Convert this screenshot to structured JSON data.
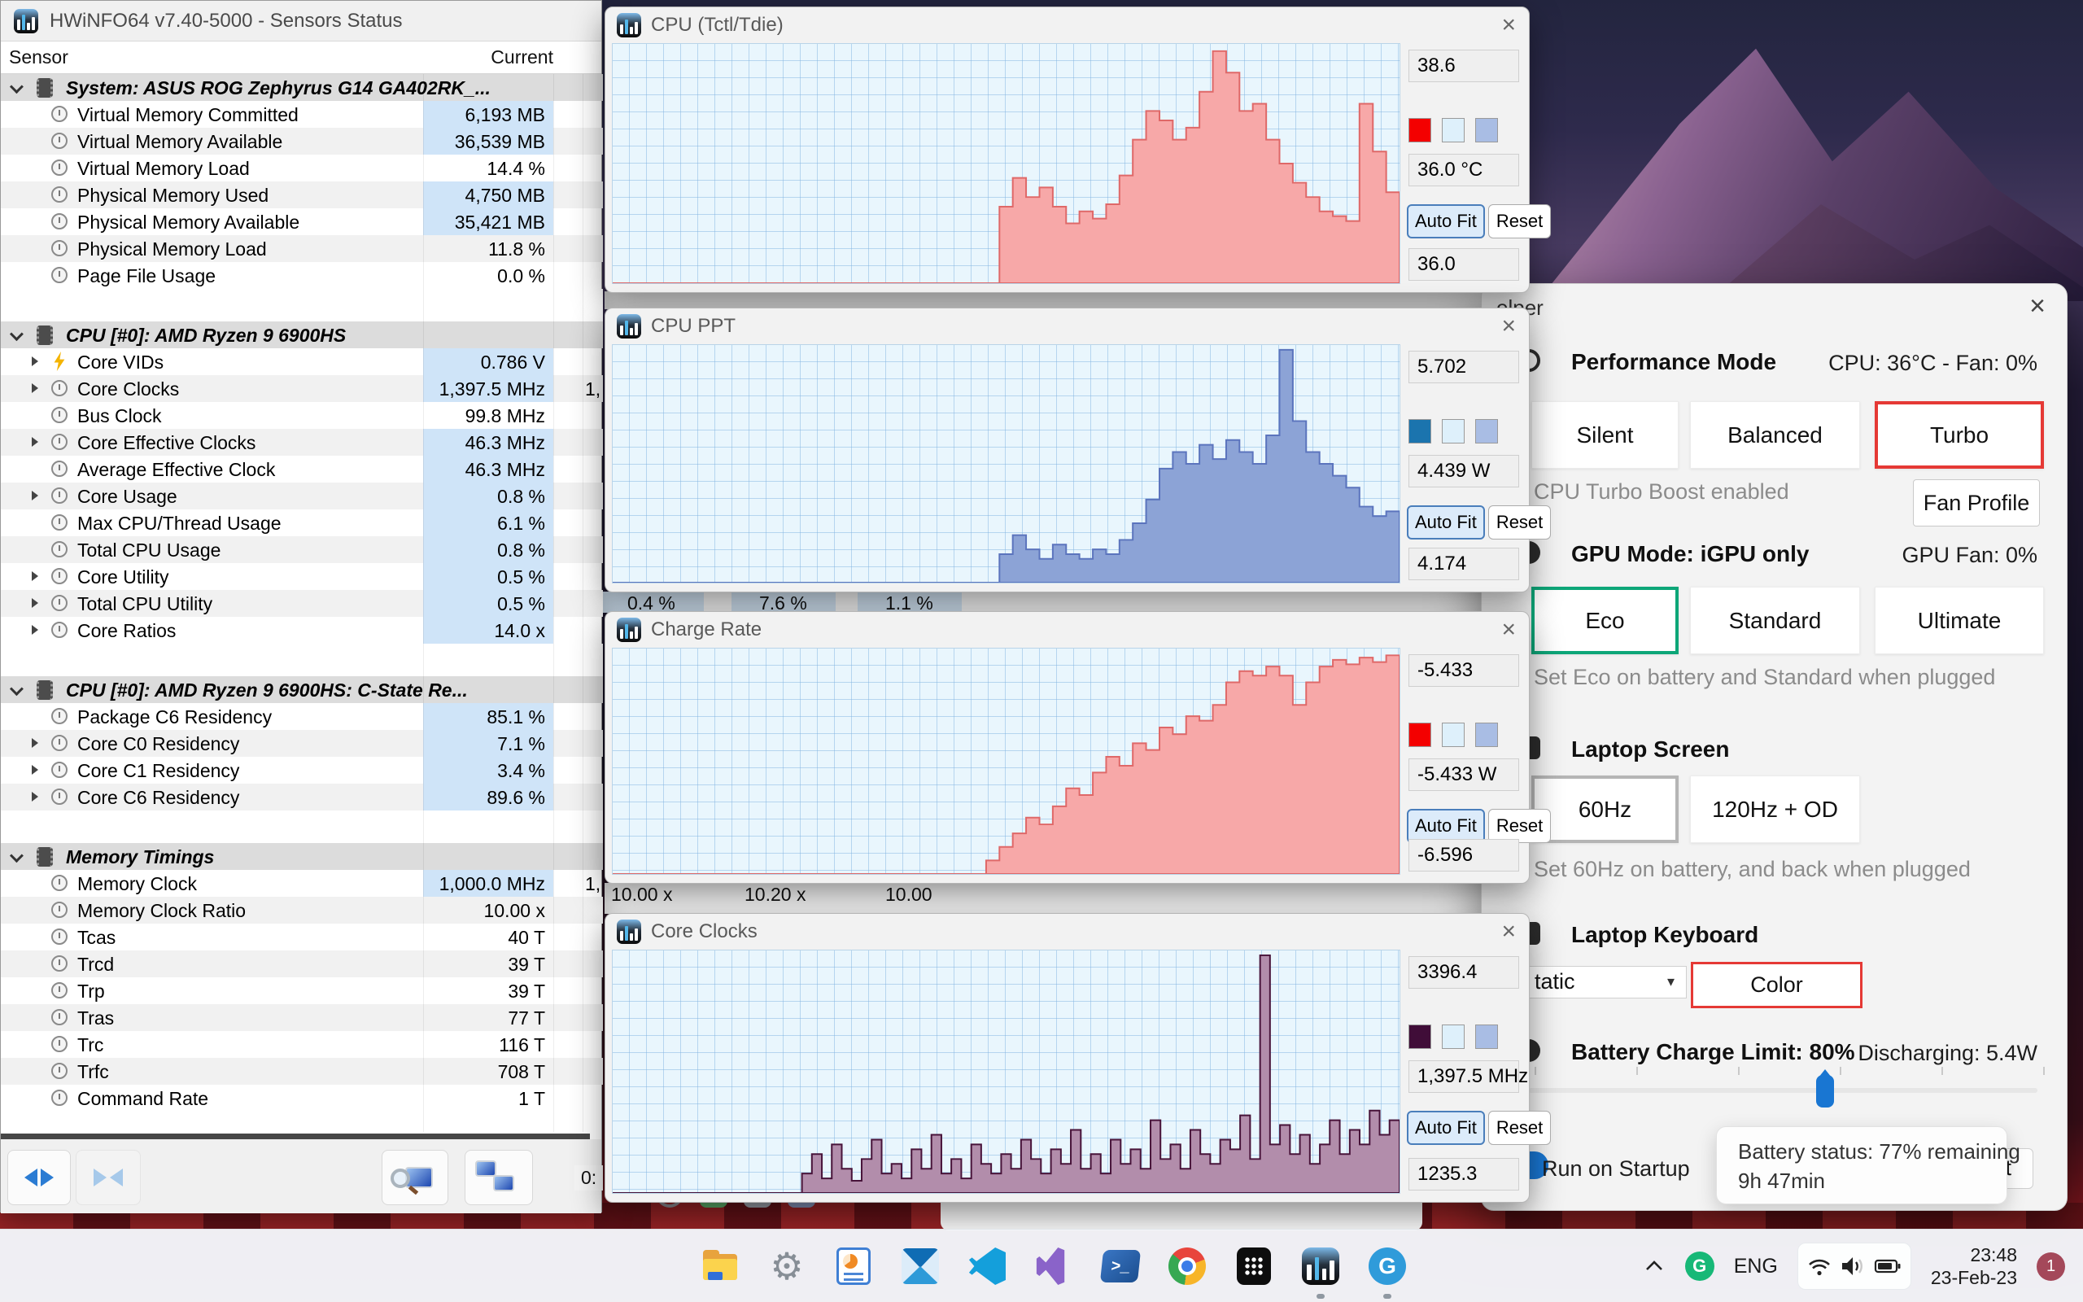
{
  "hwinfo": {
    "window_title": "HWiNFO64 v7.40-5000 - Sensors Status",
    "columns": {
      "sensor": "Sensor",
      "current": "Current"
    },
    "rows": [
      {
        "type": "section",
        "label": "System: ASUS ROG Zephyrus G14 GA402RK_..."
      },
      {
        "type": "row",
        "label": "Virtual Memory Committed",
        "value": "6,193 MB",
        "hl": true
      },
      {
        "type": "row",
        "label": "Virtual Memory Available",
        "value": "36,539 MB",
        "hl": true
      },
      {
        "type": "row",
        "label": "Virtual Memory Load",
        "value": "14.4 %"
      },
      {
        "type": "row",
        "label": "Physical Memory Used",
        "value": "4,750 MB",
        "hl": true
      },
      {
        "type": "row",
        "label": "Physical Memory Available",
        "value": "35,421 MB",
        "hl": true
      },
      {
        "type": "row",
        "label": "Physical Memory Load",
        "value": "11.8 %"
      },
      {
        "type": "row",
        "label": "Page File Usage",
        "value": "0.0 %"
      },
      {
        "type": "gap"
      },
      {
        "type": "section",
        "label": "CPU [#0]: AMD Ryzen 9 6900HS"
      },
      {
        "type": "row",
        "label": "Core VIDs",
        "value": "0.786 V",
        "hl": true,
        "expand": true,
        "icon": "bolt"
      },
      {
        "type": "row",
        "label": "Core Clocks",
        "value": "1,397.5 MHz",
        "hl": true,
        "expand": true,
        "extra": "1,"
      },
      {
        "type": "row",
        "label": "Bus Clock",
        "value": "99.8 MHz"
      },
      {
        "type": "row",
        "label": "Core Effective Clocks",
        "value": "46.3 MHz",
        "hl": true,
        "expand": true
      },
      {
        "type": "row",
        "label": "Average Effective Clock",
        "value": "46.3 MHz",
        "hl": true
      },
      {
        "type": "row",
        "label": "Core Usage",
        "value": "0.8 %",
        "hl": true,
        "expand": true
      },
      {
        "type": "row",
        "label": "Max CPU/Thread Usage",
        "value": "6.1 %",
        "hl": true
      },
      {
        "type": "row",
        "label": "Total CPU Usage",
        "value": "0.8 %",
        "hl": true
      },
      {
        "type": "row",
        "label": "Core Utility",
        "value": "0.5 %",
        "hl": true,
        "expand": true
      },
      {
        "type": "row",
        "label": "Total CPU Utility",
        "value": "0.5 %",
        "hl": true,
        "expand": true
      },
      {
        "type": "row",
        "label": "Core Ratios",
        "value": "14.0 x",
        "hl": true,
        "expand": true
      },
      {
        "type": "gap"
      },
      {
        "type": "section",
        "label": "CPU [#0]: AMD Ryzen 9 6900HS: C-State Re..."
      },
      {
        "type": "row",
        "label": "Package C6 Residency",
        "value": "85.1 %",
        "hl": true
      },
      {
        "type": "row",
        "label": "Core C0 Residency",
        "value": "7.1 %",
        "hl": true,
        "expand": true
      },
      {
        "type": "row",
        "label": "Core C1 Residency",
        "value": "3.4 %",
        "hl": true,
        "expand": true
      },
      {
        "type": "row",
        "label": "Core C6 Residency",
        "value": "89.6 %",
        "hl": true,
        "expand": true
      },
      {
        "type": "gap"
      },
      {
        "type": "section",
        "label": "Memory Timings"
      },
      {
        "type": "row",
        "label": "Memory Clock",
        "value": "1,000.0 MHz",
        "hl": true,
        "extra": "1,"
      },
      {
        "type": "row",
        "label": "Memory Clock Ratio",
        "value": "10.00 x"
      },
      {
        "type": "row",
        "label": "Tcas",
        "value": "40 T"
      },
      {
        "type": "row",
        "label": "Trcd",
        "value": "39 T"
      },
      {
        "type": "row",
        "label": "Trp",
        "value": "39 T"
      },
      {
        "type": "row",
        "label": "Tras",
        "value": "77 T"
      },
      {
        "type": "row",
        "label": "Trc",
        "value": "116 T"
      },
      {
        "type": "row",
        "label": "Trfc",
        "value": "708 T"
      },
      {
        "type": "row",
        "label": "Command Rate",
        "value": "1 T"
      }
    ],
    "toolbar_icons": [
      "expand-columns-icon",
      "collapse-columns-icon",
      "screen-magnifier-icon",
      "remote-monitors-icon"
    ]
  },
  "background_window": {
    "row_values_1": [
      "0.4 %",
      "7.6 %",
      "1.1 %"
    ],
    "row_values_2": [
      "10.00 x",
      "10.20 x",
      "10.00"
    ],
    "time_label": "0:"
  },
  "graph_common": {
    "auto_fit": "Auto Fit",
    "reset": "Reset",
    "close": "×"
  },
  "graph_windows": [
    {
      "title": "CPU (Tctl/Tdie)",
      "max": "38.6",
      "current": "36.0 °C",
      "min": "36.0",
      "swatch": "#f40000",
      "fill": "#f7a8a8",
      "stroke": "#df6868",
      "series": [
        0,
        0,
        0,
        0,
        0,
        0,
        0,
        0,
        0,
        0,
        0,
        0,
        0,
        0,
        0,
        0,
        0,
        0,
        0,
        0,
        0,
        0,
        0,
        0,
        0,
        0,
        0,
        0,
        0,
        0.32,
        0.44,
        0.36,
        0.4,
        0.32,
        0.25,
        0.3,
        0.27,
        0.33,
        0.45,
        0.6,
        0.72,
        0.68,
        0.6,
        0.65,
        0.8,
        0.97,
        0.88,
        0.72,
        0.75,
        0.6,
        0.5,
        0.42,
        0.36,
        0.3,
        0.28,
        0.26,
        0.75,
        0.55,
        0.38,
        0.3
      ]
    },
    {
      "title": "CPU PPT",
      "max": "5.702",
      "current": "4.439 W",
      "min": "4.174",
      "swatch": "#1b74ae",
      "fill": "#8ca3d6",
      "stroke": "#5b74bd",
      "series": [
        0,
        0,
        0,
        0,
        0,
        0,
        0,
        0,
        0,
        0,
        0,
        0,
        0,
        0,
        0,
        0,
        0,
        0,
        0,
        0,
        0,
        0,
        0,
        0,
        0,
        0,
        0,
        0,
        0,
        0.12,
        0.2,
        0.14,
        0.1,
        0.16,
        0.12,
        0.1,
        0.14,
        0.12,
        0.18,
        0.25,
        0.35,
        0.48,
        0.55,
        0.5,
        0.58,
        0.52,
        0.6,
        0.55,
        0.5,
        0.62,
        0.98,
        0.68,
        0.55,
        0.5,
        0.45,
        0.4,
        0.32,
        0.28,
        0.3,
        0.26
      ]
    },
    {
      "title": "Charge Rate",
      "max": "-5.433",
      "current": "-5.433 W",
      "min": "-6.596",
      "swatch": "#f40000",
      "fill": "#f7a8a8",
      "stroke": "#df6868",
      "series": [
        0,
        0,
        0,
        0,
        0,
        0,
        0,
        0,
        0,
        0,
        0,
        0,
        0,
        0,
        0,
        0,
        0,
        0,
        0,
        0,
        0,
        0,
        0,
        0,
        0,
        0,
        0,
        0,
        0.06,
        0.12,
        0.18,
        0.25,
        0.22,
        0.3,
        0.38,
        0.35,
        0.45,
        0.52,
        0.48,
        0.58,
        0.55,
        0.65,
        0.62,
        0.7,
        0.68,
        0.75,
        0.85,
        0.9,
        0.88,
        0.92,
        0.88,
        0.75,
        0.85,
        0.92,
        0.95,
        0.93,
        0.96,
        0.94,
        0.97,
        0.97
      ]
    },
    {
      "title": "Core Clocks",
      "max": "3396.4",
      "current": "1,397.5 MHz",
      "min": "1235.3",
      "swatch": "#400d38",
      "fill": "#b28dab",
      "stroke": "#471339",
      "series": [
        0,
        0,
        0,
        0,
        0,
        0,
        0,
        0,
        0,
        0,
        0,
        0,
        0,
        0,
        0,
        0,
        0,
        0,
        0,
        0.08,
        0.16,
        0.06,
        0.2,
        0.1,
        0.05,
        0.14,
        0.22,
        0.08,
        0.12,
        0.06,
        0.18,
        0.1,
        0.24,
        0.08,
        0.14,
        0.06,
        0.2,
        0.12,
        0.08,
        0.16,
        0.1,
        0.22,
        0.14,
        0.08,
        0.18,
        0.12,
        0.26,
        0.1,
        0.16,
        0.08,
        0.22,
        0.12,
        0.18,
        0.1,
        0.3,
        0.14,
        0.2,
        0.1,
        0.26,
        0.16,
        0.12,
        0.22,
        0.18,
        0.32,
        0.14,
        0.98,
        0.2,
        0.28,
        0.16,
        0.24,
        0.12,
        0.2,
        0.3,
        0.16,
        0.26,
        0.2,
        0.34,
        0.24,
        0.3,
        0.22
      ]
    }
  ],
  "ghelper": {
    "window_title_visible": "elper",
    "close": "×",
    "performance": {
      "heading": "Performance Mode",
      "status": "CPU: 36°C  -  Fan: 0%",
      "buttons": [
        "Silent",
        "Balanced",
        "Turbo"
      ],
      "active": 2,
      "note": "CPU Turbo Boost enabled",
      "fan_profile": "Fan Profile"
    },
    "gpu": {
      "heading": "GPU Mode: iGPU only",
      "status": "GPU Fan: 0%",
      "buttons": [
        "Eco",
        "Standard",
        "Ultimate"
      ],
      "active": 0,
      "note": "Set Eco on battery and Standard when plugged"
    },
    "screen": {
      "heading": "Laptop Screen",
      "buttons": [
        "60Hz",
        "120Hz + OD"
      ],
      "active": 0,
      "note": "Set 60Hz on battery, and back when plugged"
    },
    "keyboard": {
      "heading": "Laptop Keyboard",
      "dropdown_value_visible": "tatic",
      "color_button": "Color"
    },
    "battery": {
      "heading": "Battery Charge Limit: 80%",
      "status": "Discharging: 5.4W",
      "tooltip": [
        "Battery status: 77% remaining",
        "9h 47min"
      ]
    },
    "run_on_startup": "Run on Startup",
    "quit_button_visible": "it",
    "accent_red": "#e53935",
    "accent_green": "#0da678",
    "accent_blue": "#1976d2"
  },
  "taskbar": {
    "icons": [
      "start",
      "file-explorer",
      "settings",
      "system-info",
      "mail",
      "vscode",
      "visual-studio",
      "powershell",
      "chrome",
      "terminal",
      "hwinfo",
      "g-helper"
    ],
    "running": [
      "hwinfo",
      "g-helper"
    ],
    "tray": {
      "chevron_icon": "chevron-up-icon",
      "g_icon": "G",
      "language": "ENG",
      "status_icons": [
        "wifi-icon",
        "volume-icon",
        "battery-icon"
      ],
      "time": "23:48",
      "date": "23-Feb-23",
      "badge": "1"
    }
  }
}
